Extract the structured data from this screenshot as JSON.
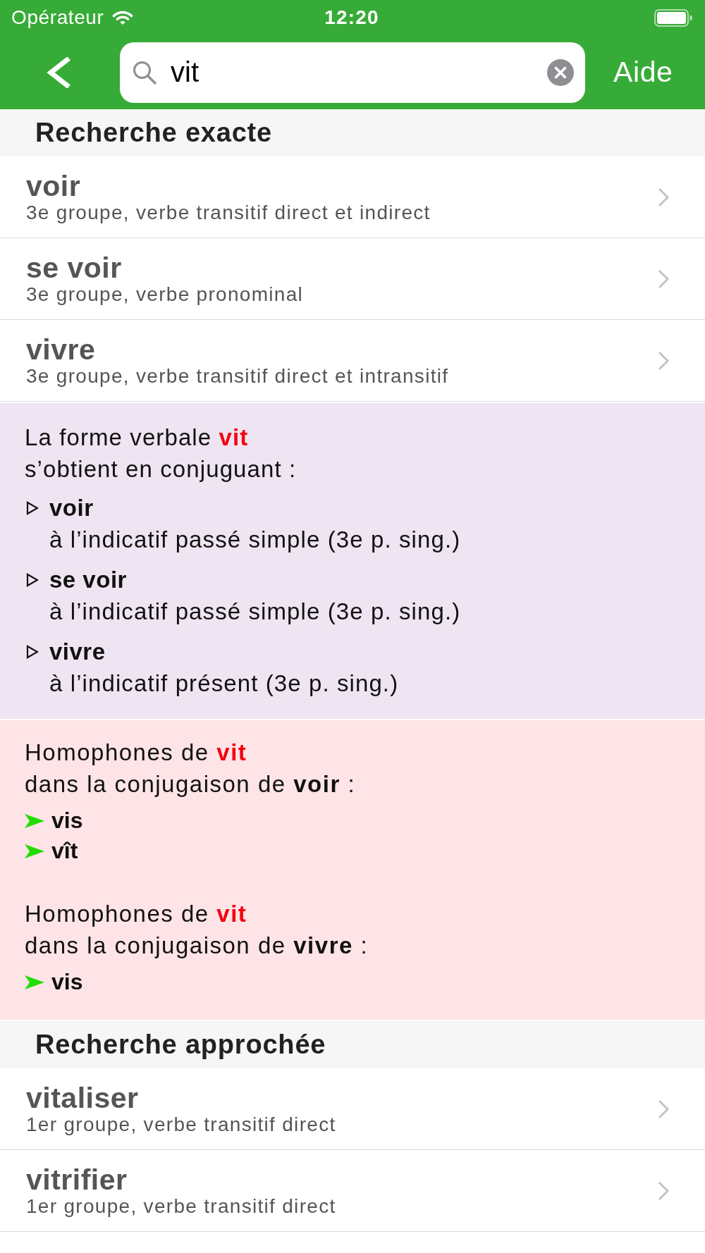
{
  "status_bar": {
    "carrier": "Opérateur",
    "time": "12:20"
  },
  "nav_bar": {
    "search": {
      "value": "vit"
    },
    "help_button": "Aide"
  },
  "sections": [
    {
      "kind": "results",
      "header": "Recherche exacte",
      "rows": [
        {
          "title": "voir",
          "subtitle": "3e groupe, verbe transitif direct et indirect"
        },
        {
          "title": "se voir",
          "subtitle": "3e groupe, verbe pronominal"
        },
        {
          "title": "vivre",
          "subtitle": "3e groupe, verbe transitif direct et intransitif"
        }
      ]
    },
    {
      "kind": "conjugation",
      "lead": "La forme verbale",
      "form": "vit",
      "line_2": "s’obtient en conjuguant :",
      "entries": [
        {
          "verb": "voir",
          "detail": "à l’indicatif passé simple (3e p. sing.)"
        },
        {
          "verb": "se voir",
          "detail": "à l’indicatif passé simple (3e p. sing.)"
        },
        {
          "verb": "vivre",
          "detail": "à l’indicatif présent (3e p. sing.)"
        }
      ]
    },
    {
      "kind": "homophones",
      "groups": [
        {
          "lead": "Homophones de",
          "form": "vit",
          "line_2": "dans la conjugaison de **voir** :",
          "words": [
            "vis",
            "vît"
          ]
        },
        {
          "lead": "Homophones de",
          "form": "vit",
          "line_2": "dans la conjugaison de **vivre** :",
          "words": [
            "vis"
          ]
        }
      ]
    },
    {
      "kind": "results",
      "header": "Recherche approchée",
      "rows": [
        {
          "title": "vitaliser",
          "subtitle": "1er groupe, verbe transitif direct"
        },
        {
          "title": "vitrifier",
          "subtitle": "1er groupe, verbe transitif direct"
        }
      ]
    }
  ]
}
